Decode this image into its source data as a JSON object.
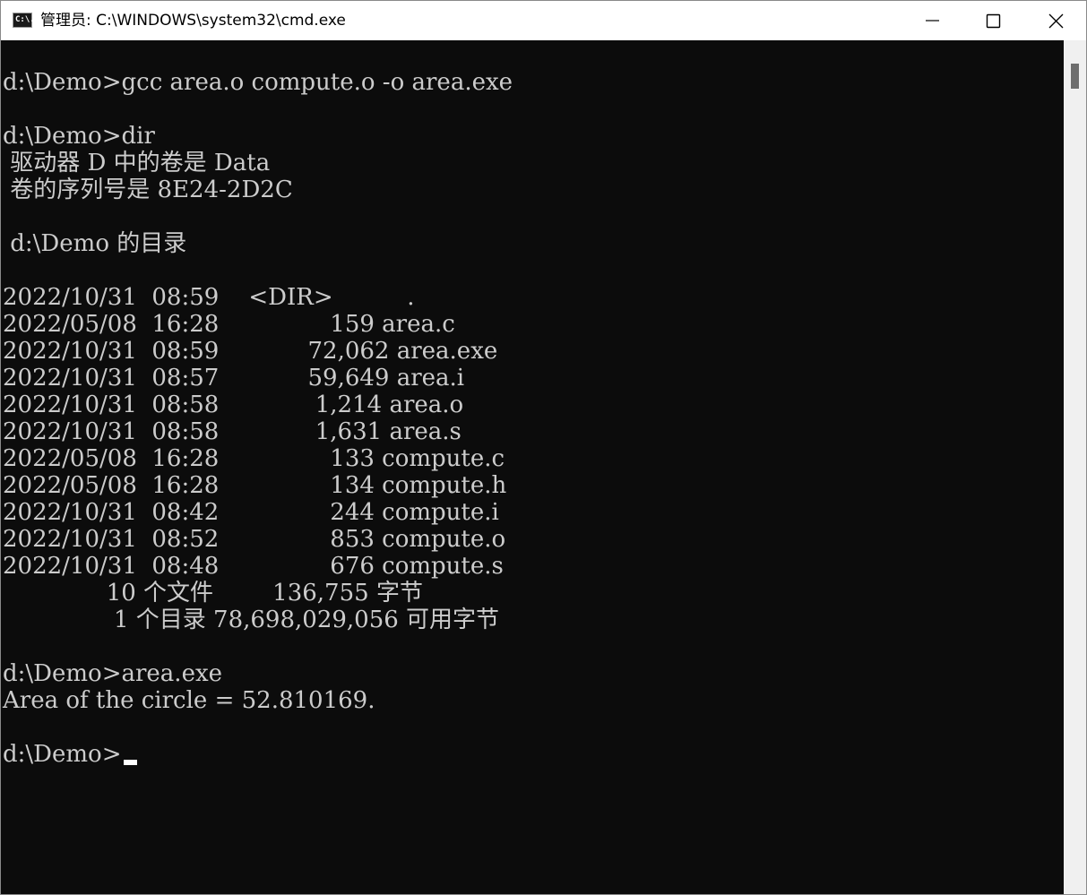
{
  "window": {
    "title": "管理员: C:\\WINDOWS\\system32\\cmd.exe",
    "icon_text": "C:\\."
  },
  "console": {
    "lines": [
      "",
      "d:\\Demo>gcc area.o compute.o -o area.exe",
      "",
      "d:\\Demo>dir",
      " 驱动器 D 中的卷是 Data",
      " 卷的序列号是 8E24-2D2C",
      "",
      " d:\\Demo 的目录",
      "",
      "2022/10/31  08:59    <DIR>          .",
      "2022/05/08  16:28               159 area.c",
      "2022/10/31  08:59            72,062 area.exe",
      "2022/10/31  08:57            59,649 area.i",
      "2022/10/31  08:58             1,214 area.o",
      "2022/10/31  08:58             1,631 area.s",
      "2022/05/08  16:28               133 compute.c",
      "2022/05/08  16:28               134 compute.h",
      "2022/10/31  08:42               244 compute.i",
      "2022/10/31  08:52               853 compute.o",
      "2022/10/31  08:48               676 compute.s",
      "              10 个文件        136,755 字节",
      "               1 个目录 78,698,029,056 可用字节",
      "",
      "d:\\Demo>area.exe",
      "Area of the circle = 52.810169.",
      "",
      "d:\\Demo>"
    ]
  }
}
